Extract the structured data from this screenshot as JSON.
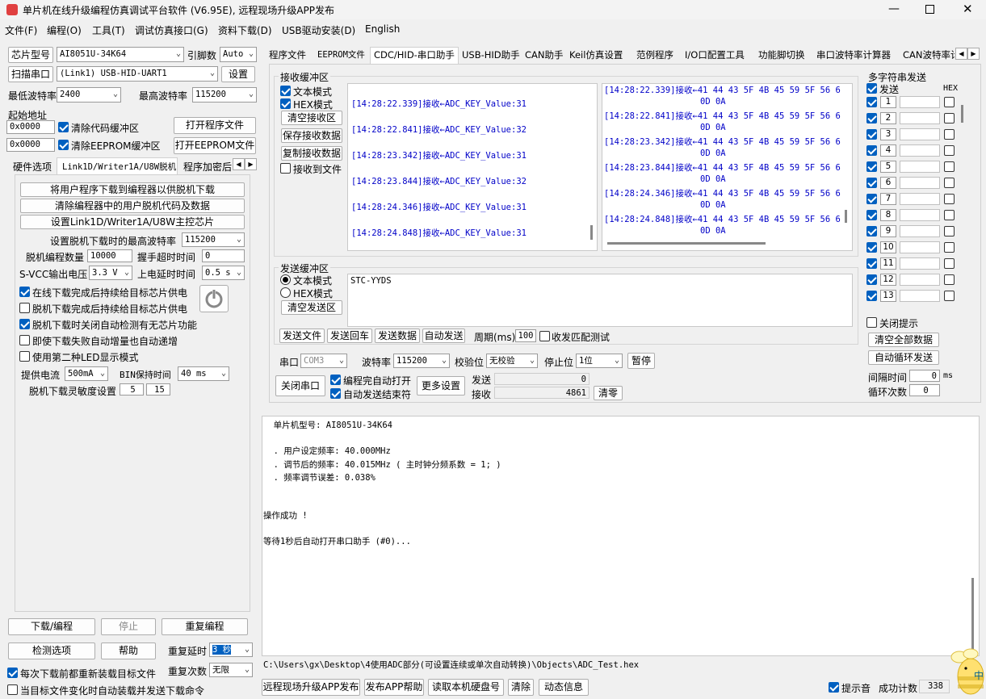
{
  "window": {
    "title": "单片机在线升级编程仿真调试平台软件 (V6.95E), 远程现场升级APP发布"
  },
  "menu": [
    "文件(F)",
    "编程(O)",
    "工具(T)",
    "调试仿真接口(G)",
    "资料下载(D)",
    "USB驱动安装(D)",
    "English"
  ],
  "left": {
    "chip_type_label": "芯片型号",
    "chip_type": "AI8051U-34K64",
    "pins_label": "引脚数",
    "pins": "Auto",
    "scan_port_label": "扫描串口",
    "port": "(Link1) USB-HID-UART1",
    "settings_label": "设置",
    "min_baud_label": "最低波特率",
    "min_baud": "2400",
    "max_baud_label": "最高波特率",
    "max_baud": "115200",
    "start_addr_label": "起始地址",
    "addr1": "0x0000",
    "clear_code_label": "清除代码缓冲区",
    "open_prog_label": "打开程序文件",
    "addr2": "0x0000",
    "clear_eeprom_label": "清除EEPROM缓冲区",
    "open_eeprom_label": "打开EEPROM文件",
    "tabs": [
      "硬件选项",
      "Link1D/Writer1A/U8W脱机",
      "程序加密后"
    ],
    "offline_btn1": "将用户程序下载到编程器以供脱机下载",
    "offline_btn2": "清除编程器中的用户脱机代码及数据",
    "offline_btn3": "设置Link1D/Writer1A/U8W主控芯片",
    "max_baud_offline_label": "设置脱机下载时的最高波特率",
    "max_baud_offline": "115200",
    "count_label": "脱机编程数量",
    "count": "10000",
    "handshake_label": "握手超时时间",
    "handshake": "0",
    "svcc_label": "S-VCC输出电压",
    "svcc": "3.3 V",
    "power_delay_label": "上电延时时间",
    "power_delay": "0.5 s",
    "opt1": "在线下载完成后持续给目标芯片供电",
    "opt2": "脱机下载完成后持续给目标芯片供电",
    "opt3": "脱机下载时关闭自动检测有无芯片功能",
    "opt4": "即使下载失败自动增量也自动递增",
    "opt5": "使用第二种LED显示模式",
    "current_label": "提供电流",
    "current": "500mA",
    "bin_hold_label": "BIN保持时间",
    "bin_hold": "40 ms",
    "sensitivity_label": "脱机下载灵敏度设置",
    "sens1": "5",
    "sens2": "15",
    "download_btn": "下载/编程",
    "stop_btn": "停止",
    "reprogram_btn": "重复编程",
    "check_btn": "检测选项",
    "help_btn": "帮助",
    "repeat_delay_label": "重复延时",
    "repeat_delay": "3 秒",
    "repeat_count_label": "重复次数",
    "repeat_count": "无限",
    "reload_label": "每次下载前都重新装载目标文件",
    "auto_reload_label": "当目标文件变化时自动装载并发送下载命令"
  },
  "tabs": [
    "程序文件",
    "EEPROM文件",
    "CDC/HID-串口助手",
    "USB-HID助手",
    "CAN助手",
    "Keil仿真设置",
    "范例程序",
    "I/O口配置工具",
    "功能脚切换",
    "串口波特率计算器",
    "CAN波特率计"
  ],
  "receive": {
    "title": "接收缓冲区",
    "text_mode": "文本模式",
    "hex_mode": "HEX模式",
    "clear": "清空接收区",
    "save": "保存接收数据",
    "copy": "复制接收数据",
    "to_file": "接收到文件",
    "text_lines": [
      "[14:28:22.339]接收←ADC_KEY_Value:31",
      "[14:28:22.841]接收←ADC_KEY_Value:32",
      "[14:28:23.342]接收←ADC_KEY_Value:31",
      "[14:28:23.844]接收←ADC_KEY_Value:32",
      "[14:28:24.346]接收←ADC_KEY_Value:31",
      "[14:28:24.848]接收←ADC_KEY_Value:31"
    ],
    "hex_lines": [
      "[14:28:22.339]接收←41 44 43 5F 4B 45 59 5F 56 6",
      "[14:28:22.841]接收←41 44 43 5F 4B 45 59 5F 56 6",
      "[14:28:23.342]接收←41 44 43 5F 4B 45 59 5F 56 6",
      "[14:28:23.844]接收←41 44 43 5F 4B 45 59 5F 56 6",
      "[14:28:24.346]接收←41 44 43 5F 4B 45 59 5F 56 6",
      "[14:28:24.848]接收←41 44 43 5F 4B 45 59 5F 56 6"
    ],
    "hex_cont": "0D 0A"
  },
  "send": {
    "title": "发送缓冲区",
    "text_mode": "文本模式",
    "hex_mode": "HEX模式",
    "clear": "清空发送区",
    "content": "STC-YYDS",
    "send_file": "发送文件",
    "send_cr": "发送回车",
    "send_data": "发送数据",
    "auto_send": "自动发送",
    "period_label": "周期(ms)",
    "period": "100",
    "match_label": "收发匹配测试"
  },
  "serial": {
    "port_label": "串口",
    "port": "COM3",
    "baud_label": "波特率",
    "baud": "115200",
    "parity_label": "校验位",
    "parity": "无校验",
    "stop_label": "停止位",
    "stop": "1位",
    "pause": "暂停",
    "close_port": "关闭串口",
    "auto_open": "编程完自动打开",
    "auto_end": "自动发送结束符",
    "more": "更多设置",
    "send_label": "发送",
    "send_count": "0",
    "recv_label": "接收",
    "recv_count": "4861",
    "clear": "清零"
  },
  "multi": {
    "title": "多字符串发送",
    "send_label": "发送",
    "hex_label": "HEX",
    "rows": [
      "1",
      "2",
      "3",
      "4",
      "5",
      "6",
      "7",
      "8",
      "9",
      "10",
      "11",
      "12",
      "13"
    ],
    "close_tip": "关闭提示",
    "clear_all": "清空全部数据",
    "auto_loop": "自动循环发送",
    "interval_label": "间隔时间",
    "interval": "0",
    "interval_unit": "ms",
    "loop_label": "循环次数",
    "loop": "0"
  },
  "log": [
    "  单片机型号: AI8051U-34K64",
    "",
    "  . 用户设定频率: 40.000MHz",
    "  . 调节后的频率: 40.015MHz ( 主时钟分频系数 = 1; )",
    "  . 频率调节误差: 0.038%",
    "",
    "",
    "操作成功 !",
    "",
    "等待1秒后自动打开串口助手 (#0)..."
  ],
  "path": "C:\\Users\\gx\\Desktop\\4使用ADC部分(可设置连续或单次自动转换)\\Objects\\ADC_Test.hex",
  "bottom": {
    "publish_app": "远程现场升级APP发布",
    "publish_help": "发布APP帮助",
    "read_disk": "读取本机硬盘号",
    "clear": "清除",
    "dynamic": "动态信息",
    "beep": "提示音",
    "success_label": "成功计数",
    "success": "338",
    "corner_char": "中"
  }
}
